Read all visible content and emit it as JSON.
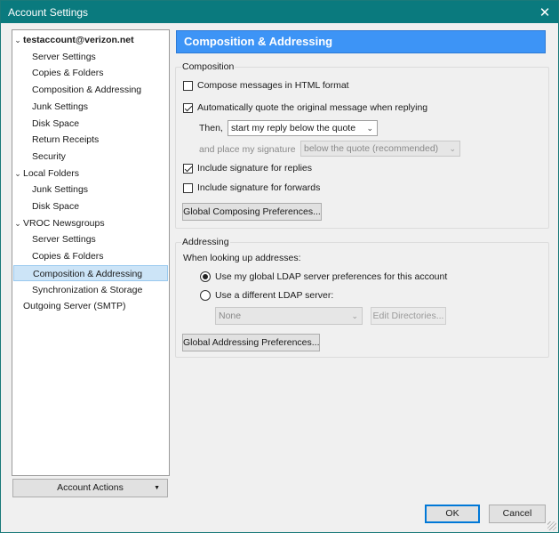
{
  "window": {
    "title": "Account Settings",
    "close_glyph": "✕"
  },
  "tree": [
    {
      "label": "testaccount@verizon.net",
      "level": 0,
      "expanded": true,
      "bold": true,
      "selected": false
    },
    {
      "label": "Server Settings",
      "level": 1,
      "selected": false
    },
    {
      "label": "Copies & Folders",
      "level": 1,
      "selected": false
    },
    {
      "label": "Composition & Addressing",
      "level": 1,
      "selected": false
    },
    {
      "label": "Junk Settings",
      "level": 1,
      "selected": false
    },
    {
      "label": "Disk Space",
      "level": 1,
      "selected": false
    },
    {
      "label": "Return Receipts",
      "level": 1,
      "selected": false
    },
    {
      "label": "Security",
      "level": 1,
      "selected": false
    },
    {
      "label": "Local Folders",
      "level": 0,
      "expanded": true,
      "bold": false,
      "selected": false
    },
    {
      "label": "Junk Settings",
      "level": 1,
      "selected": false
    },
    {
      "label": "Disk Space",
      "level": 1,
      "selected": false
    },
    {
      "label": "VROC Newsgroups",
      "level": 0,
      "expanded": true,
      "bold": false,
      "selected": false
    },
    {
      "label": "Server Settings",
      "level": 1,
      "selected": false
    },
    {
      "label": "Copies & Folders",
      "level": 1,
      "selected": false
    },
    {
      "label": "Composition & Addressing",
      "level": 1,
      "selected": true
    },
    {
      "label": "Synchronization & Storage",
      "level": 1,
      "selected": false
    },
    {
      "label": "Outgoing Server (SMTP)",
      "level": 0,
      "expanded": null,
      "bold": false,
      "selected": false
    }
  ],
  "account_actions": {
    "label": "Account Actions",
    "arrow": "▼"
  },
  "pane": {
    "title": "Composition & Addressing",
    "composition": {
      "title": "Composition",
      "html_format": {
        "label": "Compose messages in HTML format",
        "checked": false
      },
      "auto_quote": {
        "label": "Automatically quote the original message when replying",
        "checked": true
      },
      "then_label": "Then,",
      "then_select": "start my reply below the quote",
      "signature_label": "and place my signature",
      "signature_select": "below the quote (recommended)",
      "sig_replies": {
        "label": "Include signature for replies",
        "checked": true
      },
      "sig_forwards": {
        "label": "Include signature for forwards",
        "checked": false
      },
      "global_composing_button": "Global Composing Preferences..."
    },
    "addressing": {
      "title": "Addressing",
      "lookup_label": "When looking up addresses:",
      "use_global": {
        "label": "Use my global LDAP server preferences for this account",
        "checked": true
      },
      "use_different": {
        "label": "Use a different LDAP server:",
        "checked": false
      },
      "ldap_select": "None",
      "edit_directories_button": "Edit Directories...",
      "global_addressing_button": "Global Addressing Preferences..."
    }
  },
  "footer": {
    "ok": "OK",
    "cancel": "Cancel"
  },
  "colors": {
    "titlebar": "#0a7a7e",
    "header": "#3d94f6",
    "selection": "#cce4f7"
  }
}
